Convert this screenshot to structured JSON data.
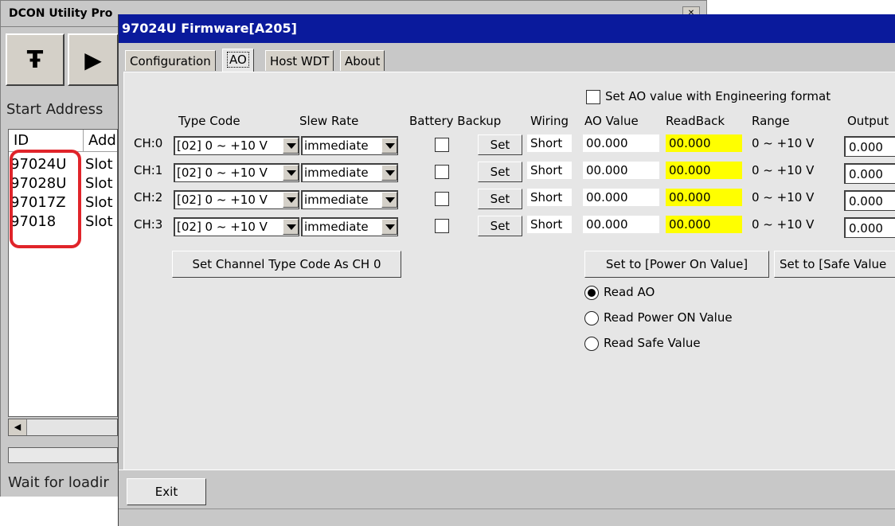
{
  "back_window": {
    "title": "DCON Utility Pro",
    "start_address_label": "Start Address",
    "list_headers": [
      "ID",
      "Add"
    ],
    "rows": [
      {
        "id": "97024U",
        "addr": "Slot"
      },
      {
        "id": "97028U",
        "addr": "Slot"
      },
      {
        "id": "97017Z",
        "addr": "Slot"
      },
      {
        "id": "97018",
        "addr": "Slot"
      }
    ],
    "status_text": "Wait for loadir"
  },
  "dialog": {
    "title": "97024U Firmware[A205]",
    "tabs": [
      "Configuration",
      "AO",
      "Host WDT",
      "About"
    ],
    "active_tab": "AO",
    "engineering_format_label": "Set AO value with Engineering format",
    "headers": {
      "type_code": "Type Code",
      "slew_rate": "Slew Rate",
      "battery_backup": "Battery Backup",
      "wiring": "Wiring",
      "ao_value": "AO Value",
      "readback": "ReadBack",
      "range": "Range",
      "output": "Output"
    },
    "channels": [
      {
        "label": "CH:0",
        "type_code": "[02] 0 ~ +10 V",
        "slew_rate": "immediate",
        "set_label": "Set",
        "wiring": "Short",
        "ao_value": "00.000",
        "readback": "00.000",
        "range": "0 ~ +10 V",
        "output": "0.000"
      },
      {
        "label": "CH:1",
        "type_code": "[02] 0 ~ +10 V",
        "slew_rate": "immediate",
        "set_label": "Set",
        "wiring": "Short",
        "ao_value": "00.000",
        "readback": "00.000",
        "range": "0 ~ +10 V",
        "output": "0.000"
      },
      {
        "label": "CH:2",
        "type_code": "[02] 0 ~ +10 V",
        "slew_rate": "immediate",
        "set_label": "Set",
        "wiring": "Short",
        "ao_value": "00.000",
        "readback": "00.000",
        "range": "0 ~ +10 V",
        "output": "0.000"
      },
      {
        "label": "CH:3",
        "type_code": "[02] 0 ~ +10 V",
        "slew_rate": "immediate",
        "set_label": "Set",
        "wiring": "Short",
        "ao_value": "00.000",
        "readback": "00.000",
        "range": "0 ~ +10 V",
        "output": "0.000"
      }
    ],
    "set_channel_type_button": "Set Channel Type Code As CH 0",
    "set_power_on_button": "Set to [Power On Value]",
    "set_safe_button": "Set to [Safe Value",
    "radio_options": [
      "Read AO",
      "Read Power ON Value",
      "Read Safe Value"
    ],
    "radio_selected": "Read AO",
    "exit_button": "Exit"
  },
  "colors": {
    "title_bar": "#0a1a9c",
    "readback_highlight": "#ffff00",
    "annotation_box": "#e0242a"
  }
}
